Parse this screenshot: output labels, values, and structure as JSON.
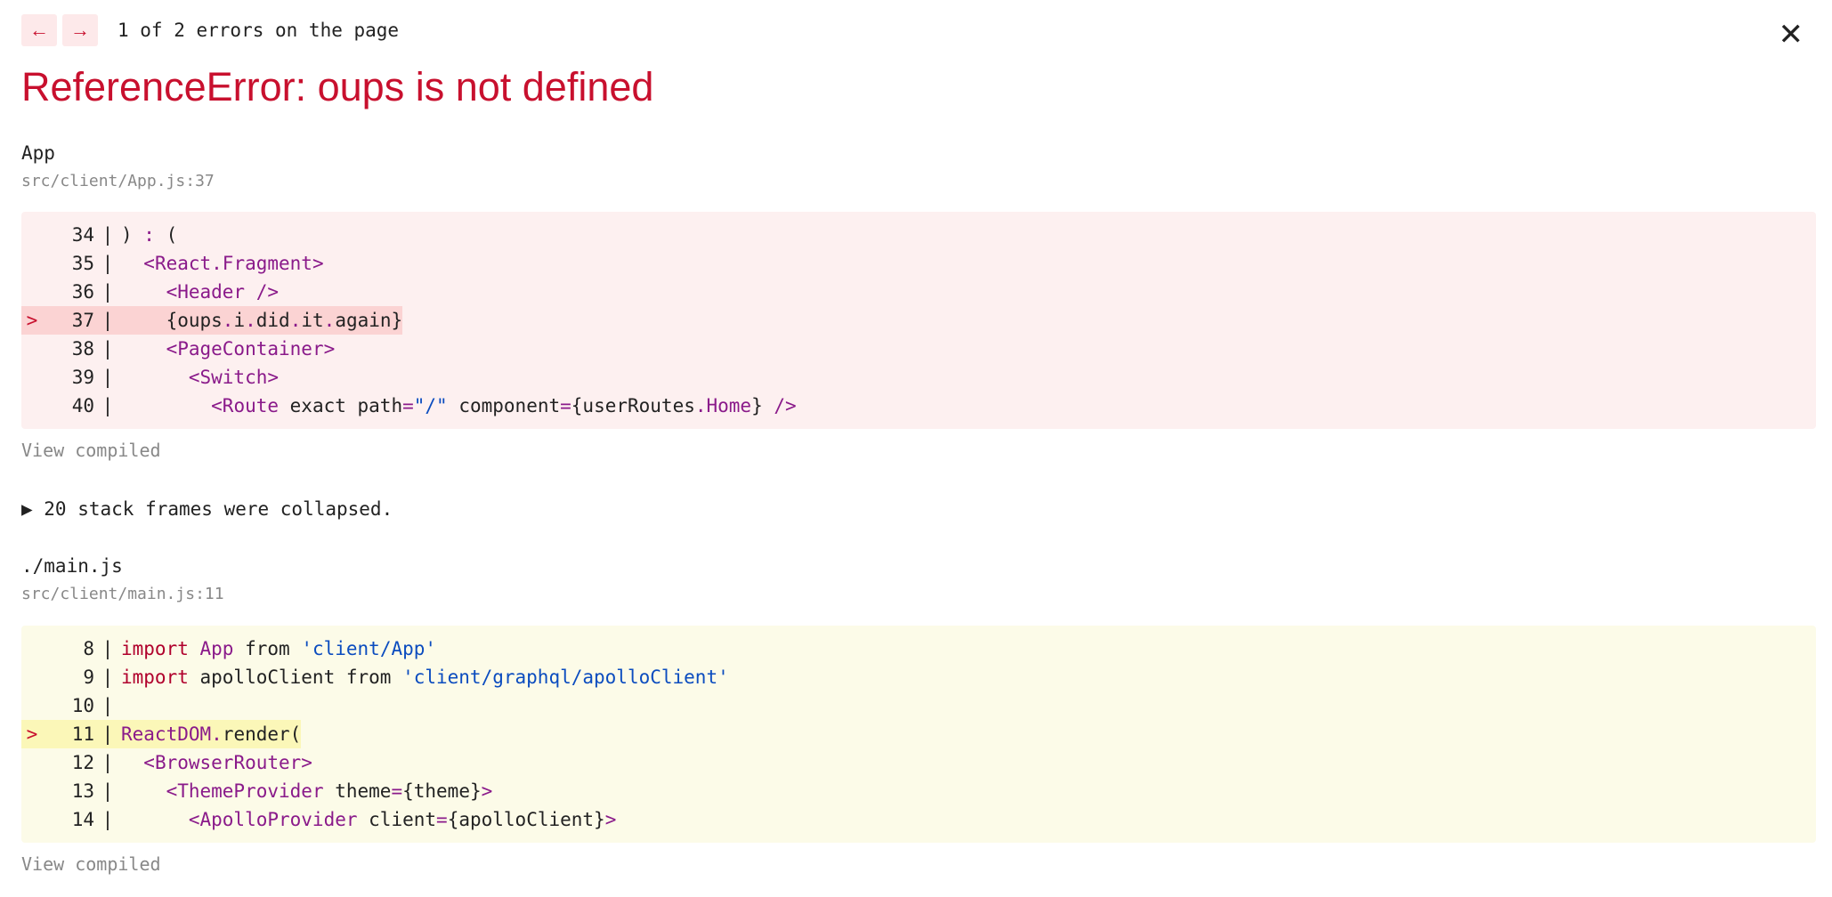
{
  "nav": {
    "prev_icon": "←",
    "next_icon": "→",
    "text": "1 of 2 errors on the page"
  },
  "close_icon": "✕",
  "title": "ReferenceError: oups is not defined",
  "frames": [
    {
      "name": "App",
      "location": "src/client/App.js:37",
      "lines": [
        {
          "num": "34",
          "marker": "",
          "content": ") : ("
        },
        {
          "num": "35",
          "marker": "",
          "content": "  <React.Fragment>"
        },
        {
          "num": "36",
          "marker": "",
          "content": "    <Header />"
        },
        {
          "num": "37",
          "marker": ">",
          "content": "    {oups.i.did.it.again}"
        },
        {
          "num": "38",
          "marker": "",
          "content": "    <PageContainer>"
        },
        {
          "num": "39",
          "marker": "",
          "content": "      <Switch>"
        },
        {
          "num": "40",
          "marker": "",
          "content": "        <Route exact path=\"/\" component={userRoutes.Home} />"
        }
      ],
      "view_compiled": "View compiled"
    },
    {
      "name": "./main.js",
      "location": "src/client/main.js:11",
      "lines": [
        {
          "num": "8",
          "marker": "",
          "content": "import App from 'client/App'"
        },
        {
          "num": "9",
          "marker": "",
          "content": "import apolloClient from 'client/graphql/apolloClient'"
        },
        {
          "num": "10",
          "marker": "",
          "content": ""
        },
        {
          "num": "11",
          "marker": ">",
          "content": "ReactDOM.render("
        },
        {
          "num": "12",
          "marker": "",
          "content": "  <BrowserRouter>"
        },
        {
          "num": "13",
          "marker": "",
          "content": "    <ThemeProvider theme={theme}>"
        },
        {
          "num": "14",
          "marker": "",
          "content": "      <ApolloProvider client={apolloClient}>"
        }
      ],
      "view_compiled": "View compiled"
    }
  ],
  "stack_toggle": "▶ 20 stack frames were collapsed.",
  "colors": {
    "error_red": "#c8102e",
    "error_bg": "#fdf0f0",
    "warn_bg": "#fcfbe8"
  }
}
